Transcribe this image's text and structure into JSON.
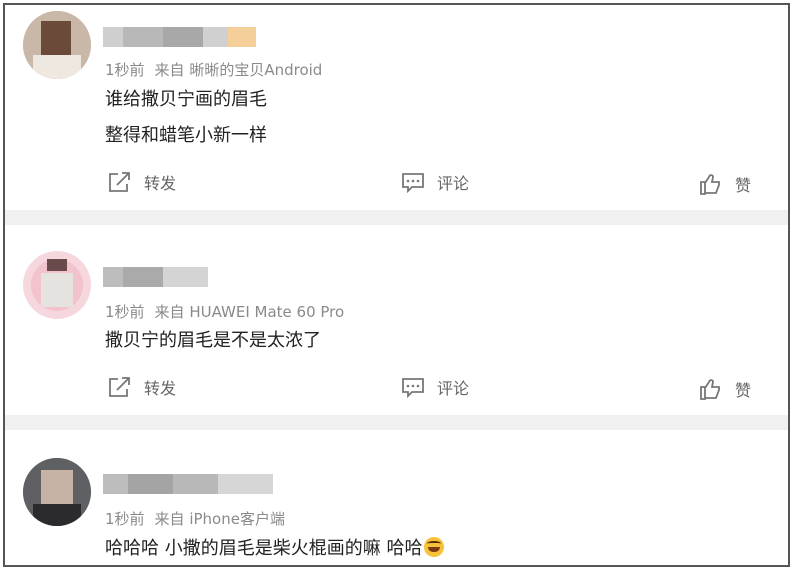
{
  "posts": [
    {
      "time": "1秒前",
      "source": "来自 晰晰的宝贝Android",
      "lines": [
        "谁给撒贝宁画的眉毛",
        "整得和蜡笔小新一样"
      ],
      "actions": {
        "repost": "转发",
        "comment": "评论",
        "like": "赞"
      }
    },
    {
      "time": "1秒前",
      "source": "来自 HUAWEI Mate 60 Pro",
      "lines": [
        "撒贝宁的眉毛是不是太浓了"
      ],
      "actions": {
        "repost": "转发",
        "comment": "评论",
        "like": "赞"
      }
    },
    {
      "time": "1秒前",
      "source": "来自 iPhone客户端",
      "lines": [
        "哈哈哈 小撒的眉毛是柴火棍画的嘛 哈哈"
      ],
      "emoji": "rolling-on-floor-laughing-emoji"
    }
  ],
  "colors": {
    "separator": "#f0f0f0",
    "meta": "#8a8a8a",
    "text": "#222222",
    "action": "#666666"
  }
}
